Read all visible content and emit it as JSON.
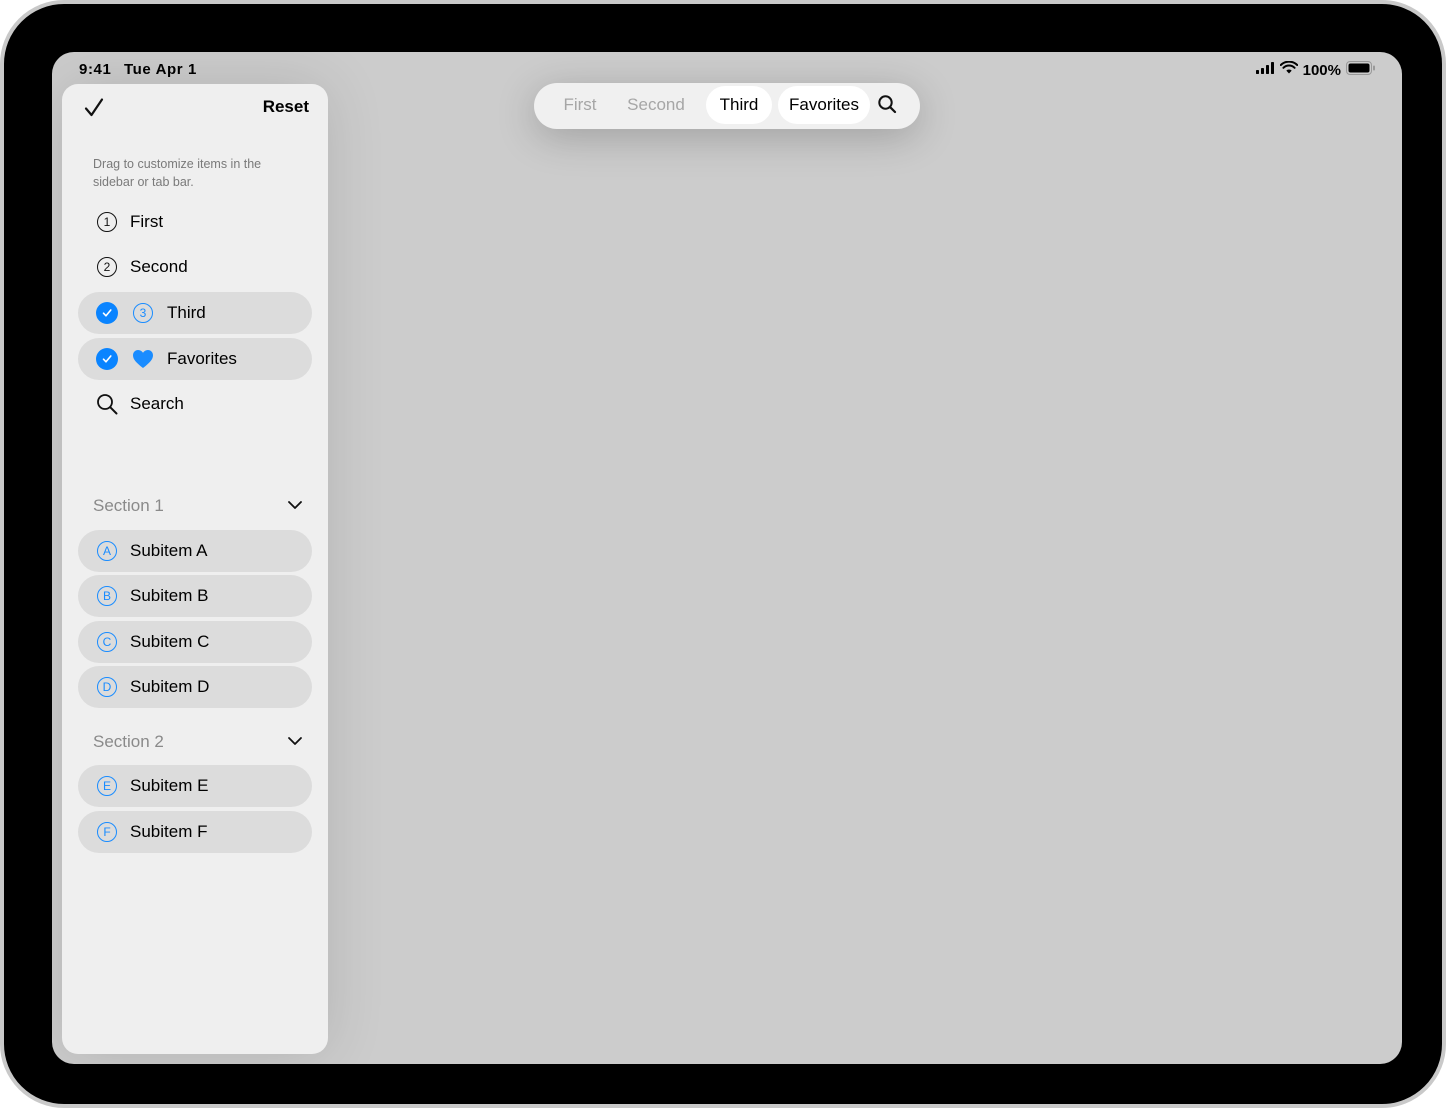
{
  "status": {
    "time": "9:41",
    "date": "Tue Apr 1",
    "battery": "100%"
  },
  "sidebar": {
    "done_icon": "checkmark-icon",
    "reset_label": "Reset",
    "hint": "Drag to customize items in the sidebar or tab bar.",
    "items": [
      {
        "label": "First",
        "icon": "1.circle",
        "selected": false
      },
      {
        "label": "Second",
        "icon": "2.circle",
        "selected": false
      },
      {
        "label": "Third",
        "icon": "3.circle",
        "selected": true
      },
      {
        "label": "Favorites",
        "icon": "heart-icon",
        "selected": true
      },
      {
        "label": "Search",
        "icon": "magnifier-icon",
        "selected": false
      }
    ],
    "sections": [
      {
        "title": "Section 1",
        "items": [
          {
            "label": "Subitem A",
            "letter": "A"
          },
          {
            "label": "Subitem B",
            "letter": "B"
          },
          {
            "label": "Subitem C",
            "letter": "C"
          },
          {
            "label": "Subitem D",
            "letter": "D"
          }
        ]
      },
      {
        "title": "Section 2",
        "items": [
          {
            "label": "Subitem E",
            "letter": "E"
          },
          {
            "label": "Subitem F",
            "letter": "F"
          }
        ]
      }
    ]
  },
  "tabbar": {
    "tabs": [
      {
        "label": "First",
        "active": false
      },
      {
        "label": "Second",
        "active": false
      },
      {
        "label": "Third",
        "active": true
      },
      {
        "label": "Favorites",
        "active": true
      }
    ],
    "search_icon": "magnifier-icon"
  },
  "colors": {
    "accent": "#0a84ff",
    "sidebar_bg": "#efefef",
    "selected_row": "#dcdcdc",
    "screen_bg": "#cccccc"
  }
}
